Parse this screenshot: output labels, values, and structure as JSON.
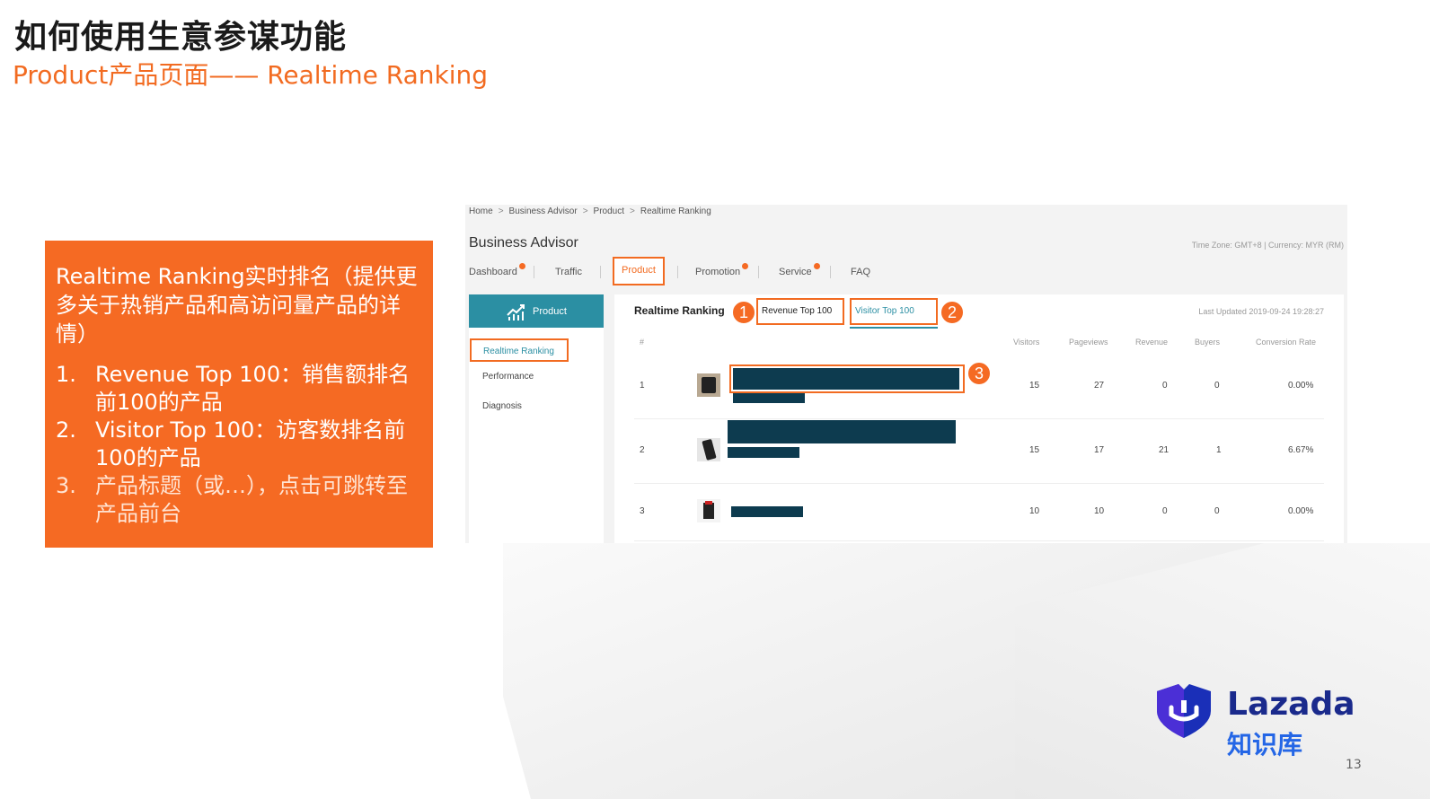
{
  "slide": {
    "title": "如何使用生意参谋功能",
    "subtitle": "Product产品页面—— Realtime Ranking",
    "page_number": "13"
  },
  "info_box": {
    "intro": "Realtime Ranking实时排名（提供更多关于热销产品和高访问量产品的详情）",
    "items": [
      {
        "num": "1.",
        "text": "Revenue Top 100：销售额排名前100的产品"
      },
      {
        "num": "2.",
        "text": "Visitor Top 100：访客数排名前100的产品"
      },
      {
        "num": "3.",
        "text": "产品标题（或…），点击可跳转至产品前台"
      }
    ]
  },
  "app": {
    "breadcrumb": [
      "Home",
      "Business Advisor",
      "Product",
      "Realtime Ranking"
    ],
    "breadcrumb_sep": ">",
    "title": "Business Advisor",
    "timezone": "Time Zone: GMT+8 | Currency: MYR (RM)",
    "tabs": [
      {
        "label": "Dashboard",
        "dot": true
      },
      {
        "label": "Traffic",
        "dot": false
      },
      {
        "label": "Product",
        "dot": false,
        "active": true
      },
      {
        "label": "Promotion",
        "dot": true
      },
      {
        "label": "Service",
        "dot": true
      },
      {
        "label": "FAQ",
        "dot": false
      }
    ],
    "sidebar": {
      "header": "Product",
      "items": [
        {
          "label": "Realtime Ranking",
          "active": true
        },
        {
          "label": "Performance"
        },
        {
          "label": "Diagnosis"
        }
      ]
    },
    "ranking": {
      "title": "Realtime Ranking",
      "subtabs": [
        "Revenue Top 100",
        "Visitor Top 100"
      ],
      "badges": [
        "1",
        "2",
        "3"
      ],
      "last_updated": "Last Updated 2019-09-24 19:28:27",
      "columns": [
        "#",
        "Visitors",
        "Pageviews",
        "Revenue",
        "Buyers",
        "Conversion Rate"
      ],
      "rows": [
        {
          "rank": "1",
          "visitors": "15",
          "pageviews": "27",
          "revenue": "0",
          "buyers": "0",
          "conversion": "0.00%"
        },
        {
          "rank": "2",
          "visitors": "15",
          "pageviews": "17",
          "revenue": "21",
          "buyers": "1",
          "conversion": "6.67%"
        },
        {
          "rank": "3",
          "visitors": "10",
          "pageviews": "10",
          "revenue": "0",
          "buyers": "0",
          "conversion": "0.00%"
        }
      ]
    }
  },
  "logo": {
    "word": "Lazada",
    "sub": "知识库"
  },
  "colors": {
    "accent_orange": "#f56a23",
    "teal": "#2b8fa3",
    "redaction": "#0d3b4f",
    "logo_navy": "#1a2a8c",
    "logo_blue": "#2466e6"
  }
}
